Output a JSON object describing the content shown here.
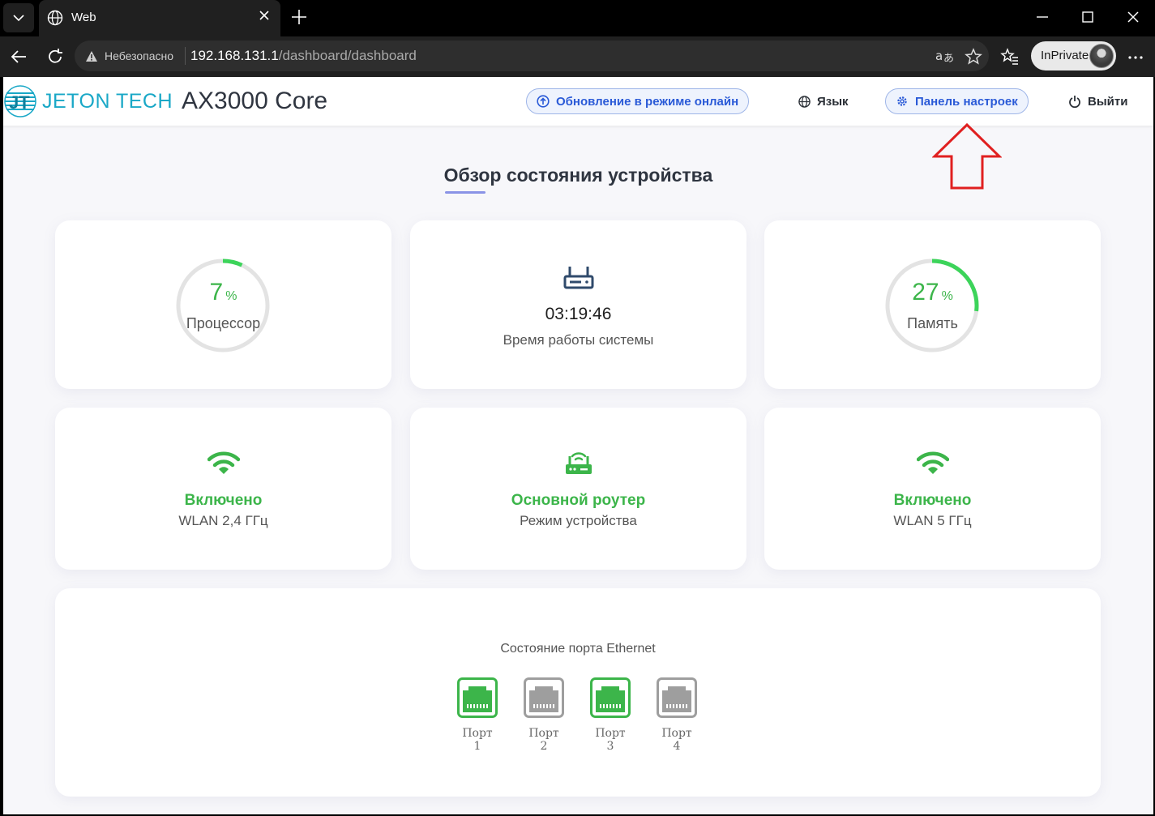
{
  "browser": {
    "tab_title": "Web",
    "address_insecure": "Небезопасно",
    "url_host": "192.168.131.1",
    "url_path": "/dashboard/dashboard",
    "profile_label": "InPrivate"
  },
  "header": {
    "brand": "JETON TECH",
    "model": "AX3000 Core",
    "online_update": "Обновление в режиме онлайн",
    "language": "Язык",
    "settings_panel": "Панель настроек",
    "logout": "Выйти"
  },
  "page": {
    "title": "Обзор состояния устройства"
  },
  "cpu": {
    "value": "7",
    "value_num": 7,
    "unit": "%",
    "label": "Процессор"
  },
  "uptime": {
    "value": "03:19:46",
    "label": "Время работы системы"
  },
  "memory": {
    "value": "27",
    "value_num": 27,
    "unit": "%",
    "label": "Память"
  },
  "wlan24": {
    "status": "Включено",
    "label": "WLAN 2,4 ГГц"
  },
  "mode": {
    "status": "Основной роутер",
    "label": "Режим устройства"
  },
  "wlan5": {
    "status": "Включено",
    "label": "WLAN 5 ГГц"
  },
  "ethernet": {
    "title": "Состояние порта Ethernet",
    "ports": [
      {
        "label": "Порт 1",
        "connected": true
      },
      {
        "label": "Порт 2",
        "connected": false
      },
      {
        "label": "Порт 3",
        "connected": true
      },
      {
        "label": "Порт 4",
        "connected": false
      }
    ]
  },
  "colors": {
    "accent_green": "#3cb54a",
    "port_gray": "#9e9e9e",
    "brand_cyan": "#1aa8c7",
    "link_blue": "#2a5ad7"
  }
}
